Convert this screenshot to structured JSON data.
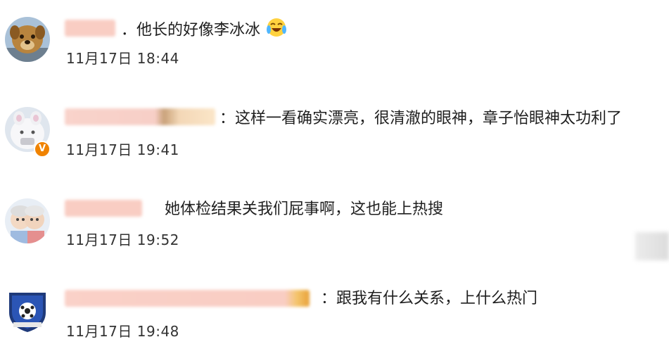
{
  "comments": [
    {
      "text": "．他长的好像李冰冰",
      "emoji": "crying-laughing-emoji",
      "time": "11月17日 18:44",
      "avatar": "brown-dog-avatar",
      "verified": false
    },
    {
      "text": "：这样一看确实漂亮，很清澈的眼神，章子怡眼神太功利了",
      "time": "11月17日 19:41",
      "avatar": "white-cartoon-bear-avatar",
      "verified": true,
      "badge": "V"
    },
    {
      "text": "她体检结果关我们屁事啊，这也能上热搜",
      "time": "11月17日 19:52",
      "avatar": "old-couple-cartoon-avatar",
      "verified": false
    },
    {
      "text": "：跟我有什么关系，上什么热门",
      "time": "11月17日 19:48",
      "avatar": "football-club-crest-avatar",
      "verified": false
    }
  ],
  "colors": {
    "name_blur": "#f7c9bf",
    "timestamp": "#333333",
    "text": "#1f1f1f",
    "verified_badge": "#f08300"
  }
}
